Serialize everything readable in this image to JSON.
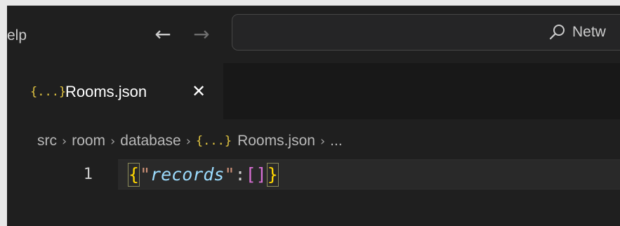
{
  "titlebar": {
    "menu_help": "elp",
    "back_glyph": "←",
    "forward_glyph": "→",
    "search_text": "Netw"
  },
  "tab": {
    "icon_glyph": "{...}",
    "label": "Rooms.json",
    "close_glyph": "✕"
  },
  "breadcrumb": {
    "items": [
      "src",
      "room",
      "database",
      "Rooms.json",
      "..."
    ],
    "separator": "›",
    "file_icon_glyph": "{...}"
  },
  "editor": {
    "line_number": "1",
    "code": {
      "open_brace": "{",
      "key_quote_open": "\"",
      "key": "records",
      "key_quote_close": "\"",
      "colon": ":",
      "open_bracket": "[",
      "close_bracket": "]",
      "close_brace": "}"
    }
  },
  "colors": {
    "background": "#1f1f1f",
    "json_icon": "#e2c541",
    "brace": "#ffd700",
    "key": "#9cdcfe",
    "bracket": "#da70d6"
  },
  "icons": {
    "search": "search-icon",
    "close": "close-icon",
    "json_file": "json-file-icon"
  }
}
